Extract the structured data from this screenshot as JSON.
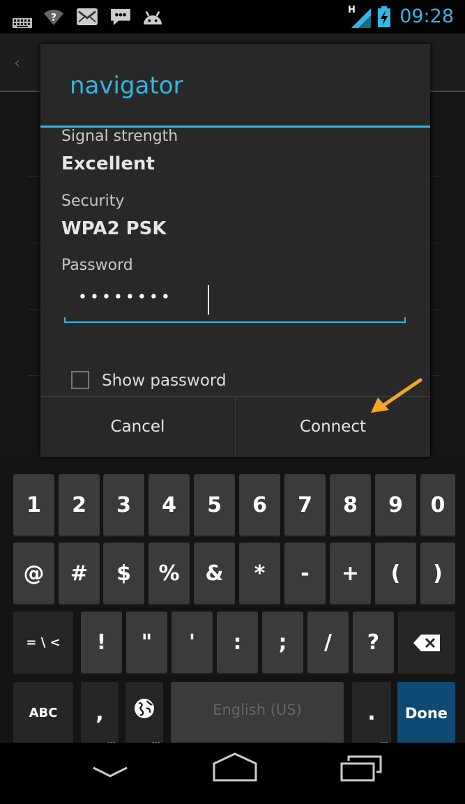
{
  "status_bar": {
    "time": "09:28",
    "network_type": "H",
    "left_icons": [
      "keyboard-icon",
      "wifi-question-icon",
      "email-icon",
      "chat-icon",
      "android-icon"
    ],
    "accent_color": "#33b5e5"
  },
  "dialog": {
    "title": "navigator",
    "signal_label": "Signal strength",
    "signal_value": "Excellent",
    "security_label": "Security",
    "security_value": "WPA2 PSK",
    "password_label": "Password",
    "password_value": "••••••••",
    "show_password_label": "Show password",
    "show_password_checked": false,
    "cancel_label": "Cancel",
    "connect_label": "Connect"
  },
  "keyboard": {
    "row1": [
      "1",
      "2",
      "3",
      "4",
      "5",
      "6",
      "7",
      "8",
      "9",
      "0"
    ],
    "row2": [
      "@",
      "#",
      "$",
      "%",
      "&",
      "*",
      "-",
      "+",
      "(",
      ")"
    ],
    "row3": [
      "= \\ <",
      "!",
      "\"",
      "'",
      ":",
      ";",
      "/",
      "?"
    ],
    "row4": {
      "abc": "ABC",
      "comma": ",",
      "space": "English (US)",
      "period": ".",
      "done": "Done"
    },
    "done_color": "#0e4a73"
  },
  "navigation": [
    "back-icon",
    "home-icon",
    "recents-icon"
  ],
  "annotation": {
    "arrow_color": "#f5a623"
  }
}
